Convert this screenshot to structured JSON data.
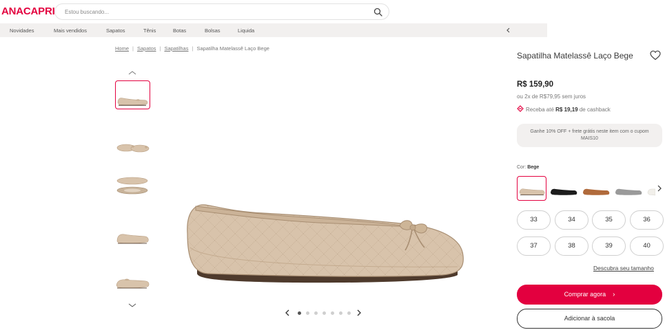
{
  "header": {
    "logo": "ANACAPRI",
    "search_placeholder": "Estou buscando..."
  },
  "nav": {
    "items": [
      "Novidades",
      "Mais vendidos",
      "Sapatos",
      "Tênis",
      "Botas",
      "Bolsas",
      "Liquida"
    ]
  },
  "breadcrumb": {
    "items": [
      "Home",
      "Sapatos",
      "Sapatilhas"
    ],
    "current": "Sapatilha Matelassê Laço Bege"
  },
  "product": {
    "title": "Sapatilha Matelassê Laço Bege",
    "price": "R$ 159,90",
    "installments": "ou 2x de R$79,95 sem juros",
    "cashback_prefix": "Receba até",
    "cashback_amount": "R$ 19,19",
    "cashback_suffix": "de cashback",
    "promo": "Ganhe 10% OFF + frete grátis neste item com o cupom MAIS10",
    "color_label": "Cor:",
    "color_value": "Bege",
    "sizes": [
      "33",
      "34",
      "35",
      "36",
      "37",
      "38",
      "39",
      "40"
    ],
    "size_guide": "Descubra seu tamanho",
    "buy_label": "Comprar agora",
    "bag_label": "Adicionar à sacola"
  },
  "carousel": {
    "dots": 7,
    "active_dot": 1
  },
  "colors": {
    "brand": "#e3003f",
    "nav_bg": "#f2f0ef",
    "shoe_beige": "#d8c3ab",
    "shoe_black": "#1c1c1c",
    "shoe_brown": "#b06a3b",
    "shoe_silver": "#9a9a9a",
    "shoe_white": "#f1efea"
  }
}
